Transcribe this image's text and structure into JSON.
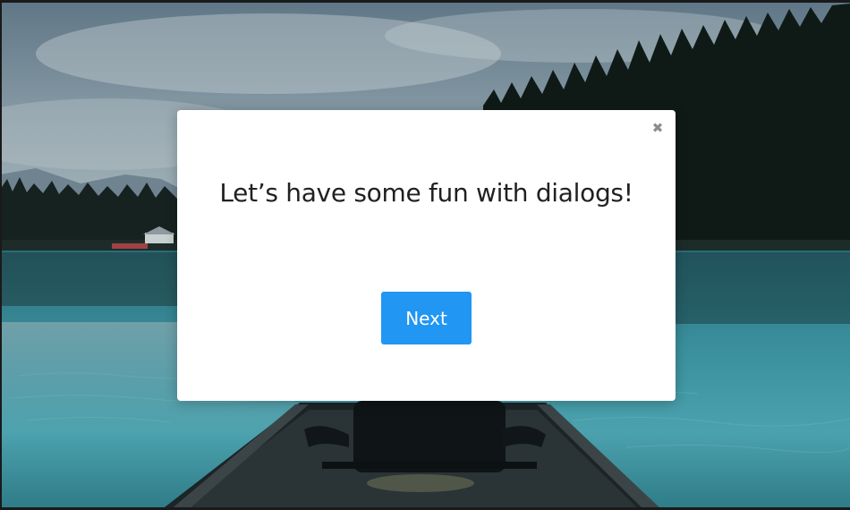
{
  "background": {
    "description_icon": "lake-canoe-scene"
  },
  "dialog": {
    "close_icon": "close-icon",
    "close_glyph": "✖",
    "title": "Let’s have some fun with dialogs!",
    "next_label": "Next",
    "accent_color": "#2196f3"
  }
}
